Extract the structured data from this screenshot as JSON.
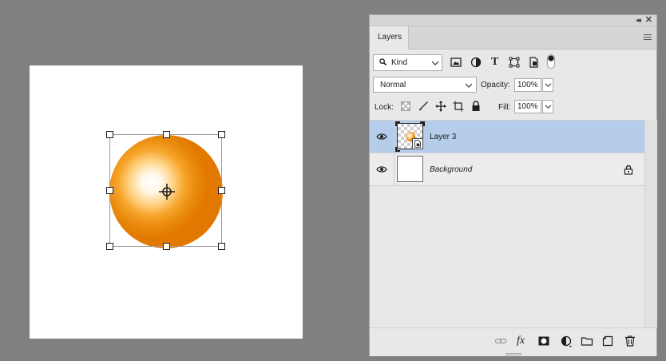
{
  "panel": {
    "collapse_glyph": "◂◂",
    "close_glyph": "✕",
    "tab_label": "Layers",
    "menu_icon": "hamburger-menu-icon"
  },
  "filter": {
    "kind_label": "Kind",
    "icons": [
      "pixel-layer-filter-icon",
      "adjustment-layer-filter-icon",
      "type-layer-filter-icon",
      "shape-layer-filter-icon",
      "smart-object-filter-icon"
    ],
    "type_glyph": "T"
  },
  "blend": {
    "mode": "Normal",
    "opacity_label": "Opacity:",
    "opacity_value": "100%"
  },
  "lock": {
    "label": "Lock:",
    "fill_label": "Fill:",
    "fill_value": "100%"
  },
  "layers": [
    {
      "name": "Layer 3",
      "selected": true,
      "type": "smart-object"
    },
    {
      "name": "Background",
      "selected": false,
      "locked": true
    }
  ],
  "bottom_icons": [
    "link-layers-icon",
    "fx-icon",
    "layer-mask-icon",
    "adjustment-layer-icon",
    "folder-icon",
    "new-layer-icon",
    "trash-icon"
  ],
  "fx_glyph": "fx",
  "colors": {
    "orb_base": "#e27800",
    "selection": "#b5cdea",
    "workspace": "#808080"
  }
}
